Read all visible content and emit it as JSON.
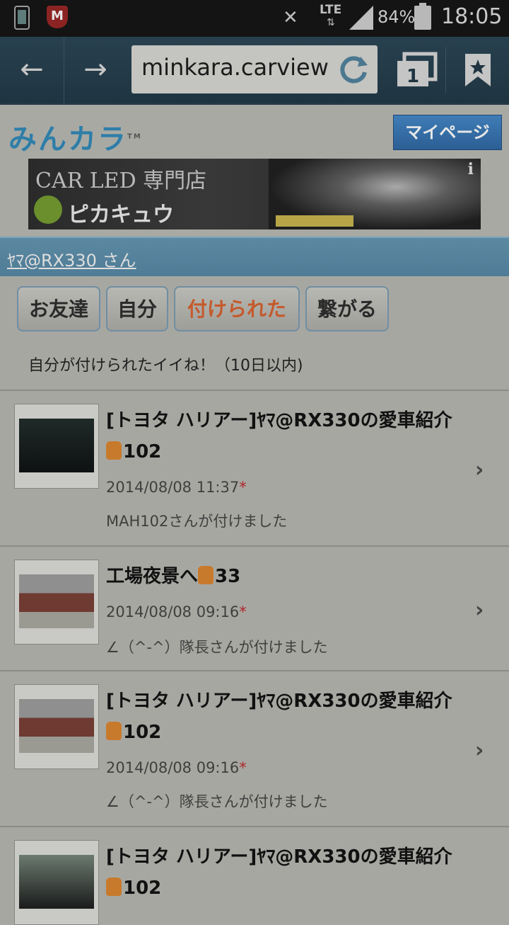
{
  "status_bar": {
    "network": "LTE",
    "battery": "84%",
    "time": "18:05",
    "icons": [
      "phone-icon",
      "mcafee-shield-icon",
      "mute-icon",
      "signal-icon",
      "battery-icon"
    ]
  },
  "browser": {
    "url": "minkara.carview",
    "back_icon": "←",
    "forward_icon": "→",
    "tab_count": "1"
  },
  "site": {
    "logo": "みんカラ",
    "mypage_label": "マイページ",
    "ad": {
      "line1": "CAR LED 専門店",
      "line2": "ピカキュウ",
      "info": "i"
    }
  },
  "user": {
    "name": "ﾔﾏ@RX330 さん"
  },
  "tabs": [
    {
      "label": "お友達",
      "active": false
    },
    {
      "label": "自分",
      "active": false
    },
    {
      "label": "付けられた",
      "active": true
    },
    {
      "label": "繋がる",
      "active": false
    }
  ],
  "subtitle": "自分が付けられたイイね！（10日以内)",
  "items": [
    {
      "title_line1": "[トヨタ ハリアー]ﾔﾏ@RX330の愛車紹介",
      "title_line2": "102",
      "date": "2014/08/08 11:37",
      "date_mark": "*",
      "by": "MAH102さんが付けました",
      "thumb": "car-night"
    },
    {
      "title_line1": "工場夜景へ",
      "title_line2": "33",
      "date": "2014/08/08 09:16",
      "date_mark": "*",
      "by": "∠（^-^）隊長さんが付けました",
      "thumb": "temple"
    },
    {
      "title_line1": "[トヨタ ハリアー]ﾔﾏ@RX330の愛車紹介",
      "title_line2": "102",
      "date": "2014/08/08 09:16",
      "date_mark": "*",
      "by": "∠（^-^）隊長さんが付けました",
      "thumb": "temple"
    },
    {
      "title_line1": "[トヨタ ハリアー]ﾔﾏ@RX330の愛車紹介",
      "title_line2": "102",
      "date": "",
      "date_mark": "",
      "by": "",
      "thumb": "car-day"
    }
  ],
  "colors": {
    "toolbar": "#1f3441",
    "active_tab_text": "#c45a2c",
    "userbar": "#4e7b95",
    "date_mark": "#b0262b"
  }
}
